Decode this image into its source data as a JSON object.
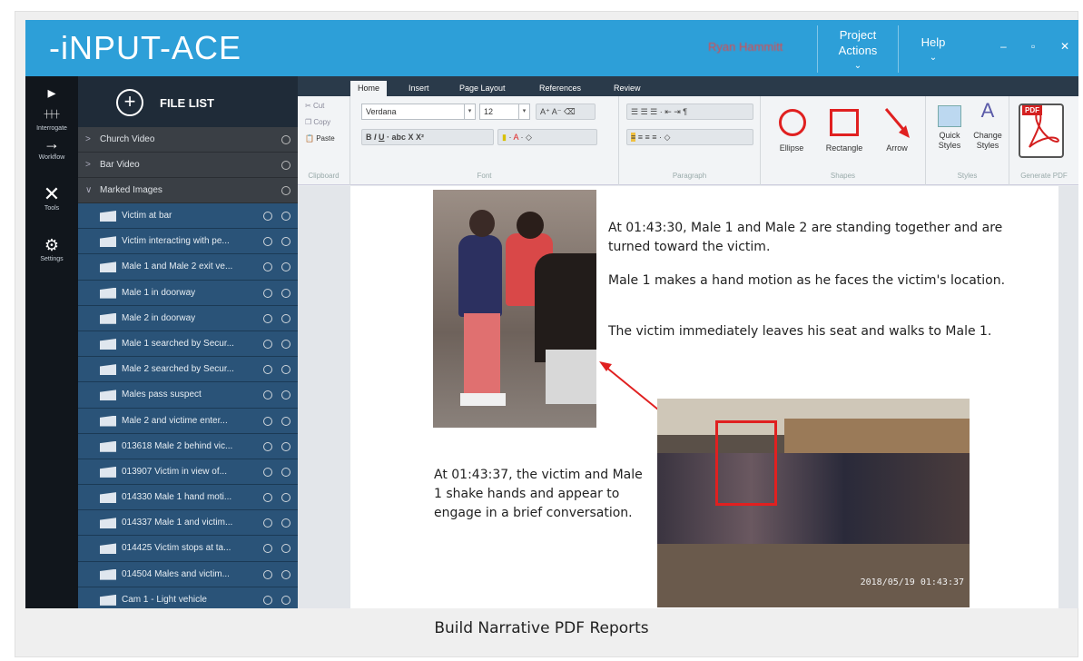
{
  "app": {
    "logo": "-iNPUT-ACE",
    "user_name": "Ryan Hammitt",
    "project_actions": "Project Actions",
    "help": "Help",
    "win_min": "–",
    "win_max": "▫",
    "win_close": "✕"
  },
  "leftnav": [
    {
      "label": "Interrogate",
      "icon": "timeline-icon"
    },
    {
      "label": "Workflow",
      "icon": "arrow-right-icon"
    },
    {
      "label": "Tools",
      "icon": "tools-icon"
    },
    {
      "label": "Settings",
      "icon": "gear-icon"
    }
  ],
  "filelist": {
    "title": "FILE LIST",
    "folders": [
      {
        "label": "Church Video",
        "expanded": false
      },
      {
        "label": "Bar Video",
        "expanded": false
      },
      {
        "label": "Marked Images",
        "expanded": true
      }
    ],
    "files": [
      "Victim at bar",
      "Victim interacting with pe...",
      "Male 1 and Male 2 exit ve...",
      "Male 1 in doorway",
      "Male 2 in doorway",
      "Male 1 searched by Secur...",
      "Male 2 searched by Secur...",
      "Males pass suspect",
      "Male 2 and victime enter...",
      "013618 Male 2 behind vic...",
      "013907 Victim in view of...",
      "014330 Male 1 hand moti...",
      "014337 Male 1 and victim...",
      "014425 Victim stops at ta...",
      "014504 Males and victim...",
      "Cam 1 - Light vehicle"
    ]
  },
  "ribbon": {
    "tabs": [
      "Home",
      "Insert",
      "Page Layout",
      "References",
      "Review"
    ],
    "active_tab": "Home",
    "clipboard": {
      "cut": "Cut",
      "copy": "Copy",
      "paste": "Paste",
      "label": "Clipboard"
    },
    "font": {
      "family": "Verdana",
      "size": "12",
      "label": "Font",
      "bold": "B",
      "italic": "I",
      "underline": "U"
    },
    "paragraph": {
      "label": "Paragraph"
    },
    "shapes": {
      "ellipse": "Ellipse",
      "rectangle": "Rectangle",
      "arrow": "Arrow",
      "label": "Shapes"
    },
    "styles": {
      "quick": "Quick Styles",
      "change": "Change Styles",
      "label": "Styles"
    },
    "generate_pdf": {
      "label": "Generate PDF",
      "tag": "PDF"
    }
  },
  "document": {
    "para1": "At 01:43:30, Male 1 and Male 2 are standing together and are turned toward the victim.",
    "para2": "Male 1 makes a hand motion as he faces the victim's location.",
    "para3": "The victim immediately leaves his seat and walks to Male 1.",
    "para4": "At 01:43:37, the victim and Male 1 shake hands and appear to engage in a brief conversation.",
    "timestamp": "2018/05/19 01:43:37"
  },
  "caption": "Build Narrative PDF Reports",
  "colors": {
    "titlebar": "#2d9fd8",
    "filelist": "#2a5378",
    "accent_red": "#e02020"
  }
}
